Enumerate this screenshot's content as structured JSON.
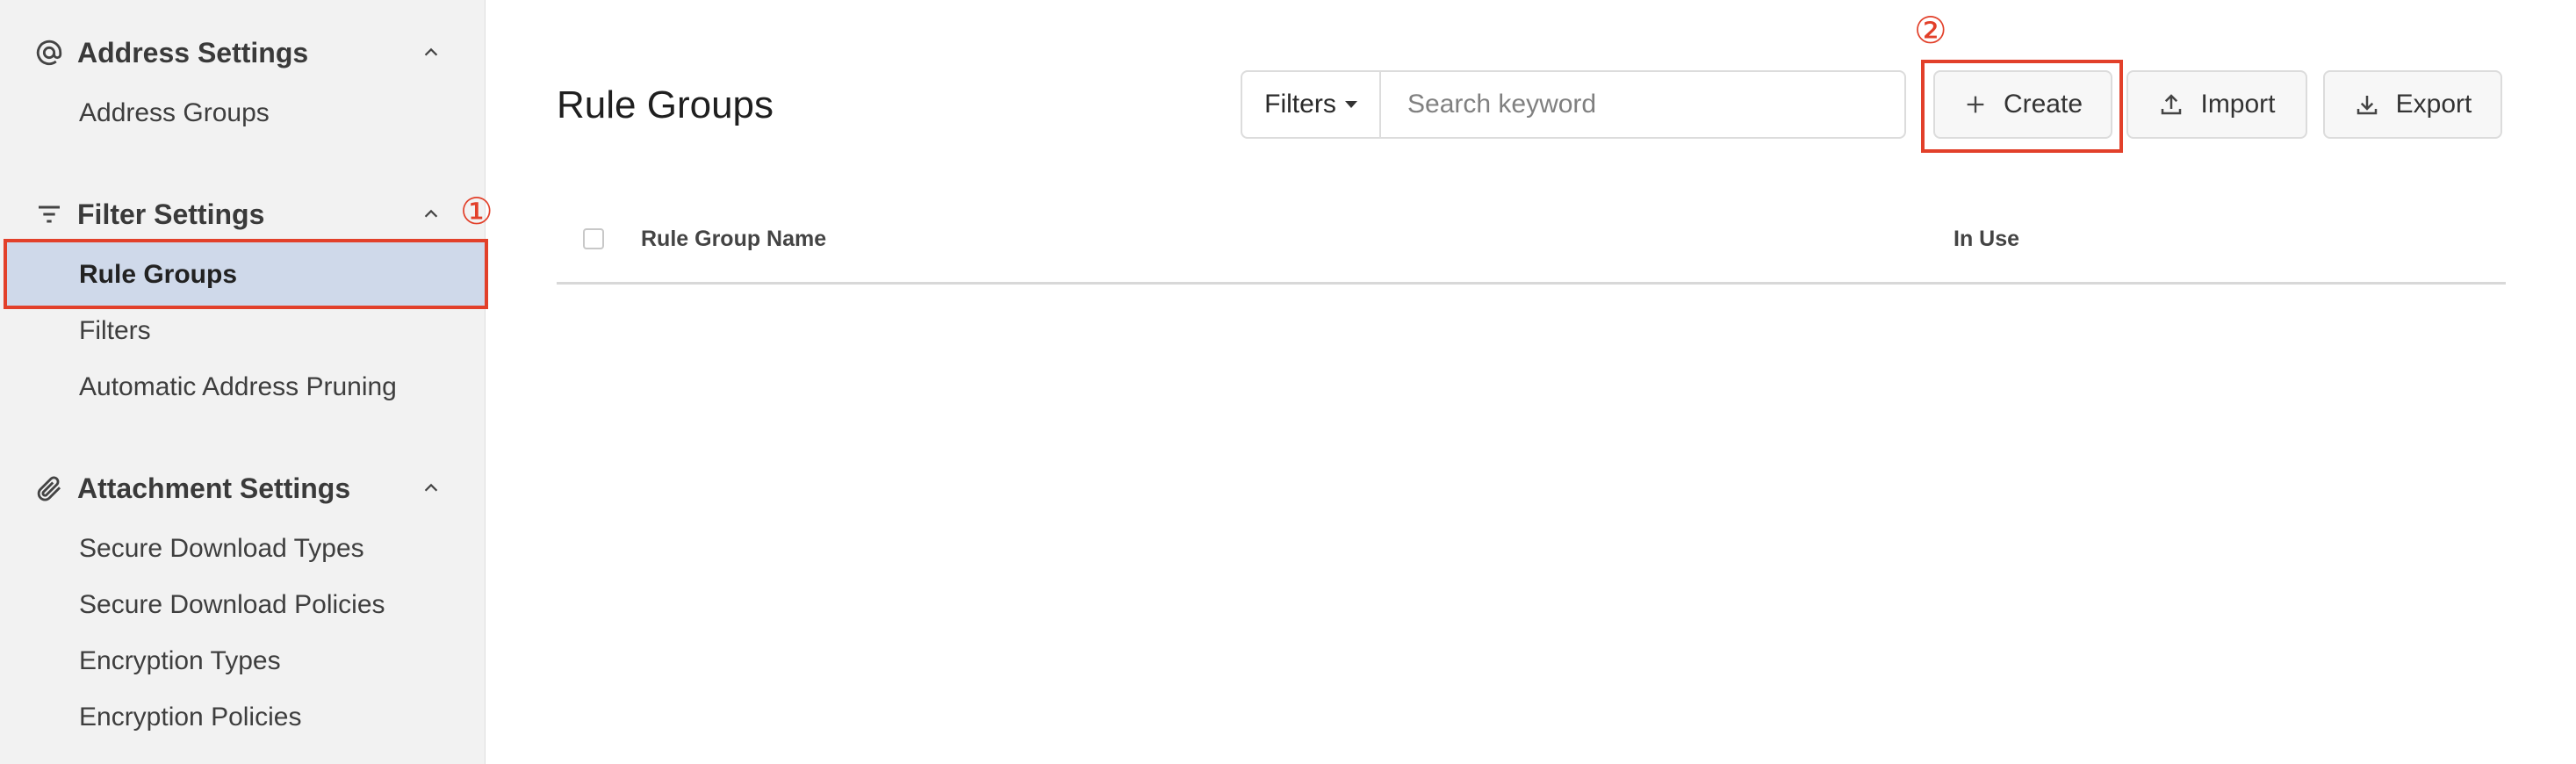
{
  "sidebar": {
    "sections": [
      {
        "label": "Address Settings",
        "icon": "at-sign-icon",
        "items": [
          "Address Groups"
        ]
      },
      {
        "label": "Filter Settings",
        "icon": "filter-lines-icon",
        "items": [
          "Rule Groups",
          "Filters",
          "Automatic Address Pruning"
        ]
      },
      {
        "label": "Attachment Settings",
        "icon": "paperclip-icon",
        "items": [
          "Secure Download Types",
          "Secure Download Policies",
          "Encryption Types",
          "Encryption Policies"
        ]
      }
    ],
    "active_item": "Rule Groups"
  },
  "main": {
    "title": "Rule Groups",
    "filters_label": "Filters",
    "search_placeholder": "Search keyword",
    "buttons": {
      "create": "Create",
      "import": "Import",
      "export": "Export"
    },
    "table": {
      "columns": [
        "Rule Group Name",
        "In Use"
      ]
    }
  },
  "annotations": {
    "marker1": "①",
    "marker2": "②"
  },
  "colors": {
    "highlight": "#e2402a",
    "active_bg": "#cfd9ea",
    "sidebar_bg": "#f2f2f2"
  }
}
